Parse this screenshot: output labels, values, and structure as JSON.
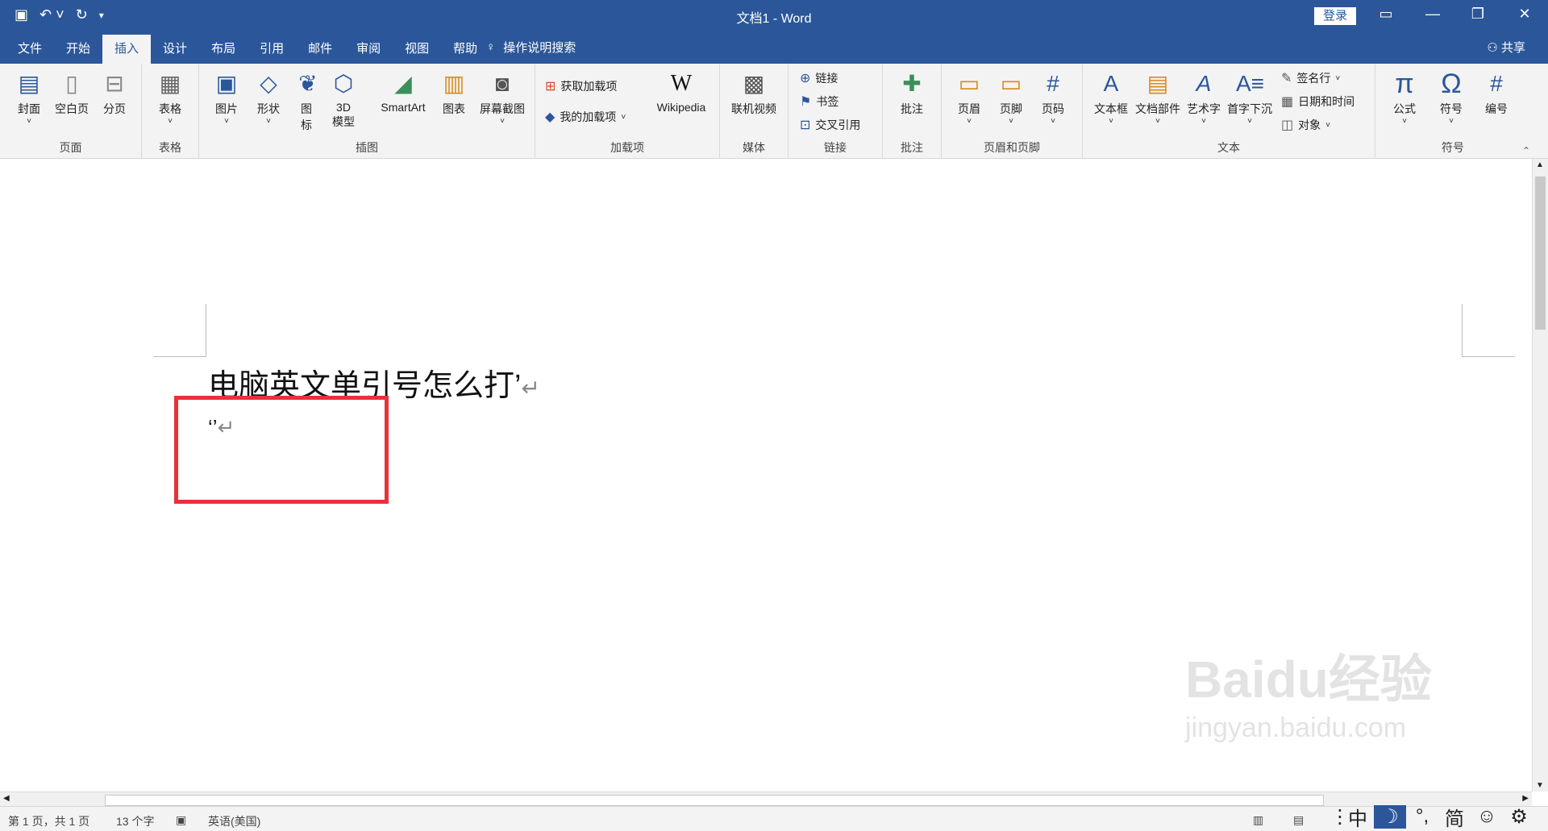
{
  "title_bar": {
    "title": "文档1  -  Word",
    "login": "登录"
  },
  "tabs": [
    "文件",
    "开始",
    "插入",
    "设计",
    "布局",
    "引用",
    "邮件",
    "审阅",
    "视图",
    "帮助"
  ],
  "tell_me": "操作说明搜索",
  "share": "共享",
  "ribbon": {
    "pages": {
      "name": "页面",
      "cover": "封面",
      "blank": "空白页",
      "break": "分页"
    },
    "tables": {
      "name": "表格",
      "table": "表格"
    },
    "illustrations": {
      "name": "插图",
      "pictures": "图片",
      "shapes": "形状",
      "icons1": "图",
      "icons2": "标",
      "model1": "3D",
      "model2": "模型",
      "smartart": "SmartArt",
      "chart": "图表",
      "screenshot": "屏幕截图"
    },
    "addins": {
      "name": "加载项",
      "get": "获取加载项",
      "my": "我的加载项",
      "wiki": "Wikipedia"
    },
    "media": {
      "name": "媒体",
      "video": "联机视频"
    },
    "links": {
      "name": "链接",
      "link": "链接",
      "bookmark": "书签",
      "crossref": "交叉引用"
    },
    "comments": {
      "name": "批注",
      "comment": "批注"
    },
    "header_footer": {
      "name": "页眉和页脚",
      "header": "页眉",
      "footer": "页脚",
      "page_number": "页码"
    },
    "text": {
      "name": "文本",
      "textbox": "文本框",
      "quickparts": "文档部件",
      "wordart": "艺术字",
      "dropcap": "首字下沉",
      "signature": "签名行",
      "datetime": "日期和时间",
      "object": "对象"
    },
    "symbols": {
      "name": "符号",
      "equation": "公式",
      "symbol": "符号",
      "number": "编号"
    }
  },
  "document": {
    "line1": "电脑英文单引号怎么打’",
    "line2": "‘’"
  },
  "status": {
    "page": "第 1 页，共 1 页",
    "words": "13 个字",
    "lang": "英语(美国)"
  },
  "ime": {
    "cn": "中",
    "moon": "☽",
    "punct": "°,",
    "simp": "简",
    "emoji": "☺",
    "gear": "⚙"
  },
  "watermark": {
    "line1": "Baidu经验",
    "line2": "jingyan.baidu.com"
  },
  "colors": {
    "brand": "#2b579a",
    "highlight": "#e8313a"
  }
}
